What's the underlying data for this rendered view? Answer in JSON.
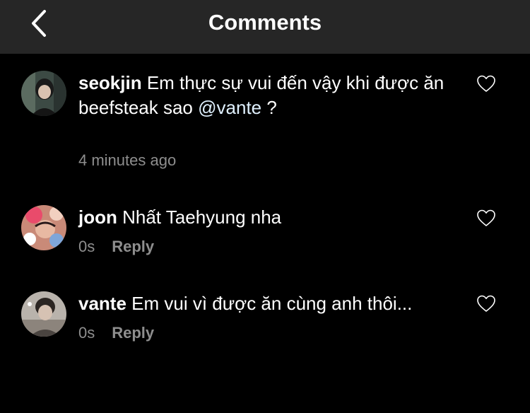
{
  "header": {
    "title": "Comments",
    "back_icon": "chevron-left-icon"
  },
  "comments": [
    {
      "username": "seokjin",
      "text_before": "Em thực sự vui đến vậy khi được ăn beefsteak sao ",
      "mention": "@vante",
      "text_after": " ?",
      "time": "4 minutes ago"
    },
    {
      "username": "joon",
      "text": "Nhất Taehyung nha",
      "time": "0s",
      "reply_label": "Reply"
    },
    {
      "username": "vante",
      "text": "Em vui vì được ăn cùng anh thôi...",
      "time": "0s",
      "reply_label": "Reply"
    }
  ],
  "icons": {
    "like": "heart-outline-icon"
  },
  "colors": {
    "background": "#000000",
    "header": "#262626",
    "text": "#ffffff",
    "meta": "#8e8e8e",
    "mention": "#e0f1ff"
  }
}
